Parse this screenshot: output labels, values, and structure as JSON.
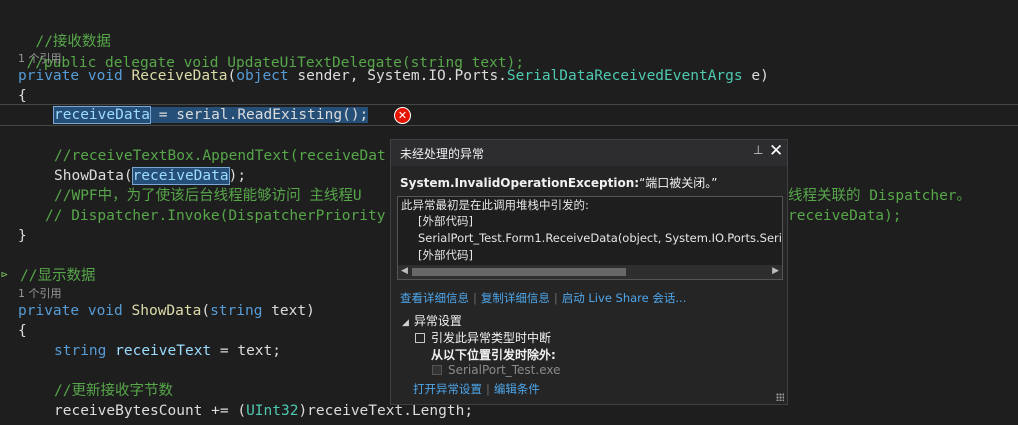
{
  "editor": {
    "l1_comment": "//接收数据",
    "l2_comment": "//public delegate void UpdateUiTextDelegate(string text);",
    "lens1": "1 个引用",
    "l3_kw1": "private",
    "l3_kw2": "void",
    "l3_fn": "ReceiveData",
    "l3_p1": "(",
    "l3_kw3": "object",
    "l3_p2": " sender, System.IO.Ports.",
    "l3_ty": "SerialDataReceivedEventArgs",
    "l3_p3": " e)",
    "l4": "{",
    "l5_var": "receiveData",
    "l5_rest": " = serial.ReadExisting();",
    "l6_comment": "//receiveTextBox.AppendText(receiveDat",
    "l7_fn": "ShowData",
    "l7_p1": "(",
    "l7_var": "receiveData",
    "l7_p2": ");",
    "l8_comment_a": "//WPF中，为了使该后台线程能够访问 主线程U",
    "l8_comment_b": "线程关联的 Dispatcher。",
    "l9_comment_a": "// Dispatcher.Invoke(DispatcherPriority",
    "l9_comment_b": "receiveData);",
    "l10": "}",
    "l11_comment": "//显示数据",
    "lens2": "1 个引用",
    "l12_kw1": "private",
    "l12_kw2": "void",
    "l12_fn": "ShowData",
    "l12_p1": "(",
    "l12_kw3": "string",
    "l12_p2": " text)",
    "l13": "{",
    "l14_kw": "string",
    "l14_var": "receiveText",
    "l14_p": " = text;",
    "l15_comment": "//更新接收字节数",
    "l16_a": "receiveBytesCount += (",
    "l16_ty": "UInt32",
    "l16_b": ")receiveText.Length;"
  },
  "exception_popup": {
    "title": "未经处理的异常",
    "pin_icon": "pin-icon",
    "close_icon": "close-icon",
    "exception_type": "System.InvalidOperationException:",
    "exception_message": "“端口被关闭。”",
    "stack_header": "此异常最初是在此调用堆栈中引发的:",
    "stack_frames": [
      "[外部代码]",
      "SerialPort_Test.Form1.ReceiveData(object, System.IO.Ports.Seri",
      "[外部代码]"
    ],
    "links": [
      "查看详细信息",
      "复制详细信息",
      "启动 Live Share 会话..."
    ],
    "settings_header": "异常设置",
    "break_on_type": "引发此异常类型时中断",
    "except_from": "从以下位置引发时除外:",
    "except_item": "SerialPort_Test.exe",
    "bottom_links": [
      "打开异常设置",
      "编辑条件"
    ]
  },
  "colors": {
    "background": "#1e1e1e",
    "keyword": "#569cd6",
    "type": "#4ec9b0",
    "function": "#dcdcaa",
    "comment": "#57a64a",
    "link": "#4ea6ea",
    "error": "#e51400"
  }
}
